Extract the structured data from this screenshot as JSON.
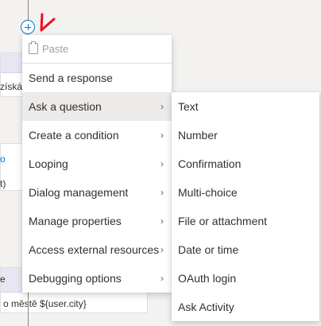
{
  "canvas": {
    "background_color": "#f3f2f1",
    "connector_color": "#8a8886",
    "accent_color": "#0078d4"
  },
  "background_fragments": {
    "fragment_1": "získán",
    "fragment_2": "o",
    "fragment_3": "t)",
    "fragment_4": "e",
    "fragment_5": "o městě ${user.city}"
  },
  "main_menu": {
    "items": [
      {
        "label": "Paste",
        "icon": "paste-icon",
        "disabled": true
      },
      {
        "label": "Send a response"
      },
      {
        "label": "Ask a question",
        "has_submenu": true,
        "active": true
      },
      {
        "label": "Create a condition",
        "has_submenu": true
      },
      {
        "label": "Looping",
        "has_submenu": true
      },
      {
        "label": "Dialog management",
        "has_submenu": true
      },
      {
        "label": "Manage properties",
        "has_submenu": true
      },
      {
        "label": "Access external resources",
        "has_submenu": true
      },
      {
        "label": "Debugging options",
        "has_submenu": true
      }
    ],
    "chevron": "›"
  },
  "sub_menu": {
    "items": [
      {
        "label": "Text"
      },
      {
        "label": "Number"
      },
      {
        "label": "Confirmation"
      },
      {
        "label": "Multi-choice"
      },
      {
        "label": "File or attachment"
      },
      {
        "label": "Date or time"
      },
      {
        "label": "OAuth login"
      },
      {
        "label": "Ask Activity"
      }
    ]
  },
  "annotations": {
    "color": "#e81123"
  }
}
